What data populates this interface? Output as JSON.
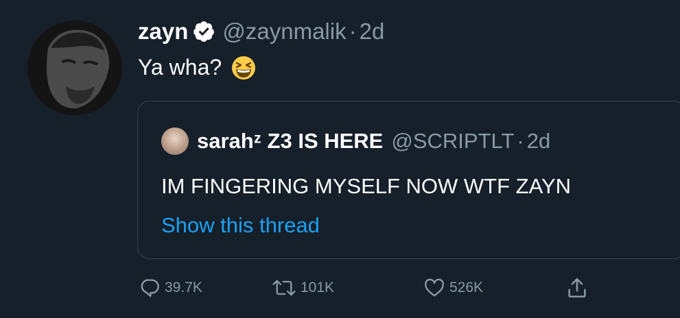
{
  "tweet": {
    "author_name": "zayn",
    "author_handle": "@zaynmalik",
    "separator": "·",
    "time": "2d",
    "text": "Ya wha?",
    "emoji_icon": "grinning-squinting-face-icon",
    "verified_icon": "verified-badge-icon"
  },
  "quoted_tweet": {
    "author_name": "sarahᶻ Z3 IS HERE",
    "author_handle": "@SCRIPTLT",
    "separator": "·",
    "time": "2d",
    "text": "IM FINGERING MYSELF NOW WTF ZAYN",
    "link": "Show this thread"
  },
  "actions": {
    "replies": "39.7K",
    "retweets": "101K",
    "likes": "526K"
  },
  "colors": {
    "background": "#15202b",
    "text_primary": "#ffffff",
    "text_secondary": "#8899a6",
    "link": "#1da1f2",
    "border": "#38444d"
  }
}
